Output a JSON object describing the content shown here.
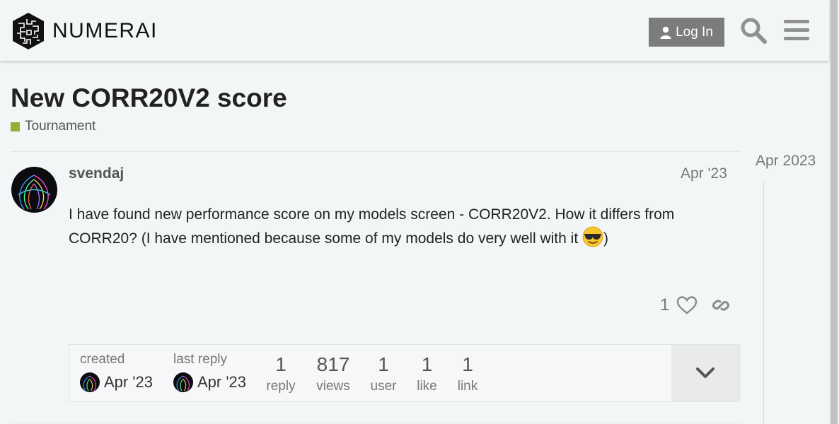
{
  "site": {
    "name": "NUMERAI"
  },
  "header": {
    "login_label": "Log In"
  },
  "topic": {
    "title": "New CORR20V2 score",
    "category": "Tournament",
    "category_color": "#92b134"
  },
  "timeline": {
    "date": "Apr 2023"
  },
  "post": {
    "username": "svendaj",
    "date": "Apr '23",
    "body_line1": "I have found new performance score on my models screen - CORR20V2. How it differs from CORR20? (I have mentioned because some of my models do very well with it ",
    "emoji": "sunglasses",
    "body_end": ")",
    "likes": "1"
  },
  "topic_map": {
    "created_label": "created",
    "created_date": "Apr '23",
    "last_reply_label": "last reply",
    "last_reply_date": "Apr '23",
    "stats": [
      {
        "num": "1",
        "label": "reply"
      },
      {
        "num": "817",
        "label": "views"
      },
      {
        "num": "1",
        "label": "user"
      },
      {
        "num": "1",
        "label": "like"
      },
      {
        "num": "1",
        "label": "link"
      }
    ]
  },
  "colors": {
    "accent_button": "#7c7c7c",
    "category": "#92b134"
  },
  "icons": [
    "numerai-logo",
    "user-icon",
    "search-icon",
    "hamburger-menu-icon",
    "heart-icon",
    "link-icon",
    "chevron-down-icon",
    "sunglasses-emoji"
  ]
}
